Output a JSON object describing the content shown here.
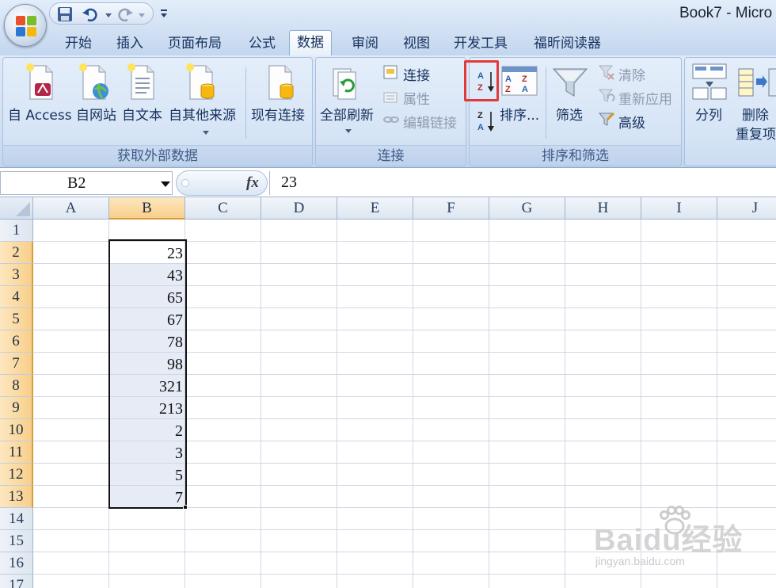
{
  "window": {
    "title": "Book7 - Micro"
  },
  "tabs": [
    {
      "label": "开始"
    },
    {
      "label": "插入"
    },
    {
      "label": "页面布局"
    },
    {
      "label": "公式"
    },
    {
      "label": "数据"
    },
    {
      "label": "审阅"
    },
    {
      "label": "视图"
    },
    {
      "label": "开发工具"
    },
    {
      "label": "福昕阅读器"
    }
  ],
  "active_tab": "数据",
  "ribbon": {
    "external": {
      "label": "获取外部数据",
      "access": "自 Access",
      "web": "自网站",
      "text": "自文本",
      "other": "自其他来源",
      "existing": "现有连接"
    },
    "connections": {
      "label": "连接",
      "refresh_all": "全部刷新",
      "connections": "连接",
      "properties": "属性",
      "edit_links": "编辑链接"
    },
    "sort_filter": {
      "label": "排序和筛选",
      "sort": "排序...",
      "filter": "筛选",
      "clear": "清除",
      "reapply": "重新应用",
      "advanced": "高级"
    },
    "data_tools": {
      "text_to_columns": "分列",
      "remove_line1": "删除",
      "remove_line2": "重复项"
    }
  },
  "formula_bar": {
    "name_box": "B2",
    "fx": "fx",
    "value": "23"
  },
  "grid": {
    "columns": [
      "A",
      "B",
      "C",
      "D",
      "E",
      "F",
      "G",
      "H",
      "I",
      "J"
    ],
    "rows": [
      "1",
      "2",
      "3",
      "4",
      "5",
      "6",
      "7",
      "8",
      "9",
      "10",
      "11",
      "12",
      "13",
      "14",
      "15",
      "16",
      "17"
    ],
    "selected_column": "B",
    "selected_rows": [
      "2",
      "3",
      "4",
      "5",
      "6",
      "7",
      "8",
      "9",
      "10",
      "11",
      "12",
      "13"
    ],
    "column_b_values": [
      "23",
      "43",
      "65",
      "67",
      "78",
      "98",
      "321",
      "213",
      "2",
      "3",
      "5",
      "7"
    ]
  },
  "watermark": {
    "brand": "Baidu经验",
    "url": "jingyan.baidu.com"
  },
  "colors": {
    "highlight": "#e23a3a",
    "selection_header": "#f8cf8a",
    "ribbon": "#d0dff2"
  }
}
